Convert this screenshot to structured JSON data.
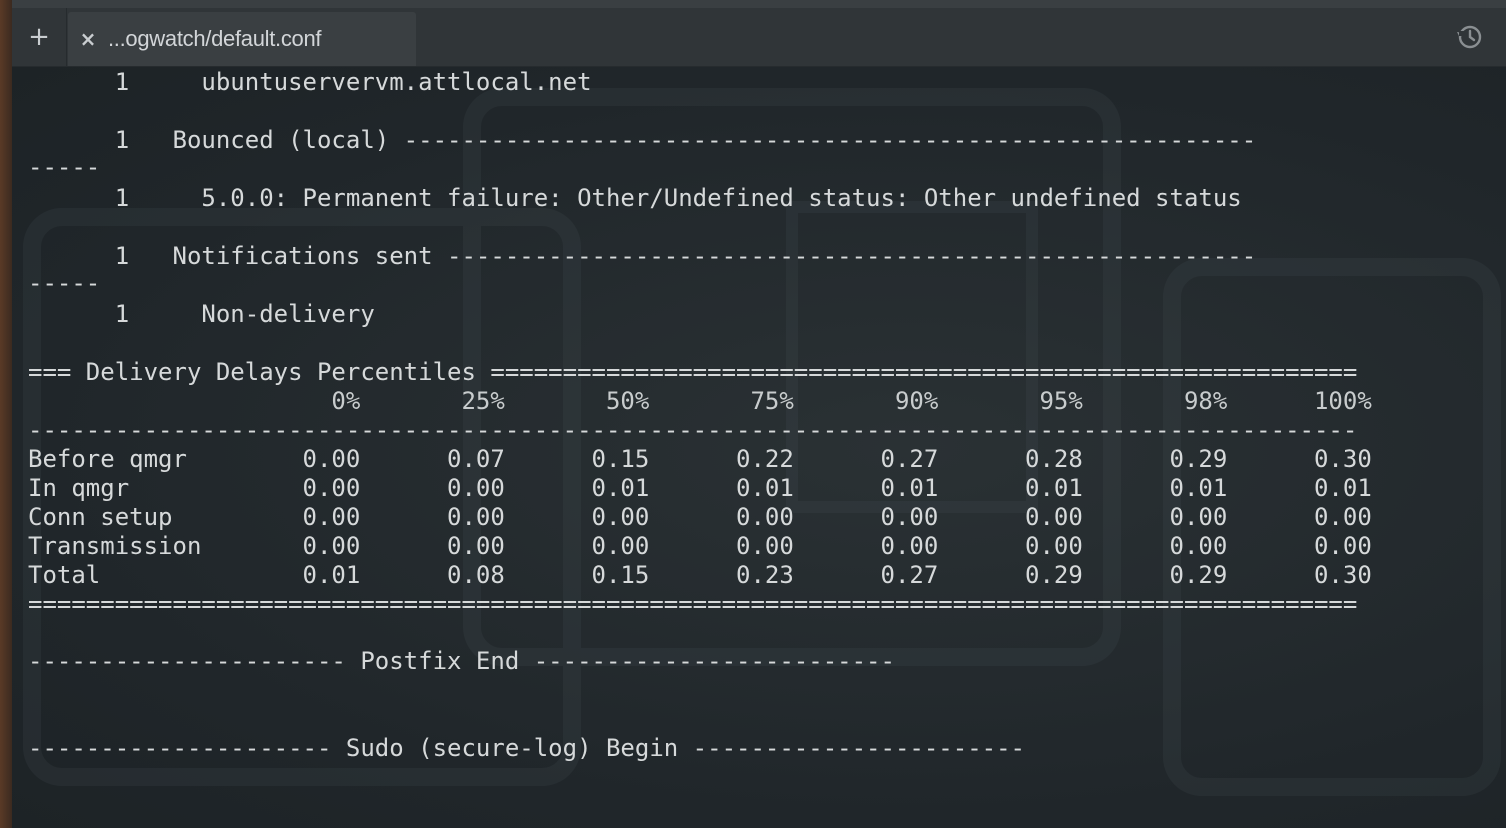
{
  "tabs": {
    "new_tab_label": "+",
    "close_label": "×",
    "active_title": "...ogwatch/default.conf",
    "history_icon": "history-icon"
  },
  "terminal": {
    "lines": [
      "      1     ubuntuservervm.attlocal.net",
      "      1   Bounced (local) -----------------------------------------------------------",
      "-----",
      "      1     5.0.0: Permanent failure: Other/Undefined status: Other undefined status",
      "      1   Notifications sent --------------------------------------------------------",
      "-----",
      "      1     Non-delivery",
      "=== Delivery Delays Percentiles ============================================================",
      "                     0%       25%       50%       75%       90%       95%       98%      100%",
      "--------------------------------------------------------------------------------------------",
      "Before qmgr        0.00      0.07      0.15      0.22      0.27      0.28      0.29      0.30",
      "In qmgr            0.00      0.00      0.01      0.01      0.01      0.01      0.01      0.01",
      "Conn setup         0.00      0.00      0.00      0.00      0.00      0.00      0.00      0.00",
      "Transmission       0.00      0.00      0.00      0.00      0.00      0.00      0.00      0.00",
      "Total              0.01      0.08      0.15      0.23      0.27      0.29      0.29      0.30",
      "============================================================================================",
      "---------------------- Postfix End -------------------------",
      "--------------------- Sudo (secure-log) Begin -----------------------"
    ]
  },
  "colors": {
    "terminal_bg": "#22282b",
    "terminal_fg": "#d6d9da",
    "tabbar_bg": "#303538"
  }
}
